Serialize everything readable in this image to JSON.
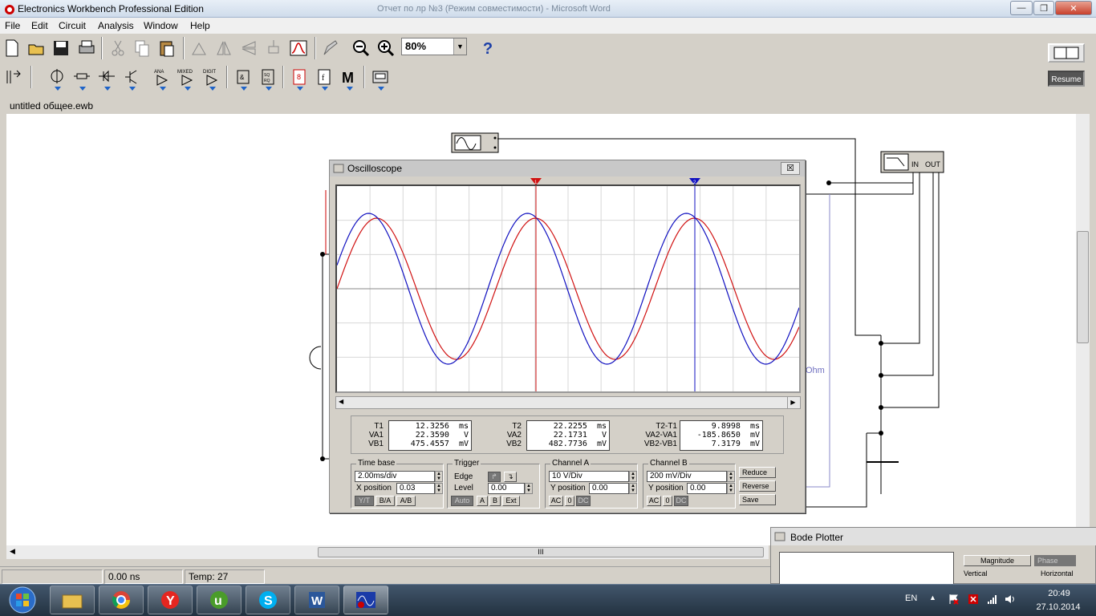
{
  "window": {
    "title": "Electronics Workbench Professional Edition",
    "background_title": "Отчет по лр №3 (Режим совместимости) - Microsoft Word"
  },
  "menu": [
    "File",
    "Edit",
    "Circuit",
    "Analysis",
    "Window",
    "Help"
  ],
  "toolbar": {
    "zoom": "80%",
    "help": "?",
    "resume": "Resume",
    "parts_bins": [
      "ANA",
      "MIXED",
      "DIGIT"
    ]
  },
  "document": {
    "title": "untitled общее.ewb"
  },
  "circuit": {
    "resistor_unit": "Ohm"
  },
  "oscilloscope": {
    "title": "Oscilloscope",
    "close": "☒",
    "cursor1": "1",
    "cursor2": "2",
    "readouts": {
      "t1": {
        "label": "T1",
        "value": "12.3256  ms"
      },
      "va1": {
        "label": "VA1",
        "value": "22.3590   V"
      },
      "vb1": {
        "label": "VB1",
        "value": "475.4557  mV"
      },
      "t2": {
        "label": "T2",
        "value": "22.2255  ms"
      },
      "va2": {
        "label": "VA2",
        "value": "22.1731   V"
      },
      "vb2": {
        "label": "VB2",
        "value": "482.7736  mV"
      },
      "dt": {
        "label": "T2-T1",
        "value": "9.8998  ms"
      },
      "dva": {
        "label": "VA2-VA1",
        "value": "-185.8650  mV"
      },
      "dvb": {
        "label": "VB2-VB1",
        "value": "7.3179  mV"
      }
    },
    "timebase": {
      "label": "Time base",
      "value": "2.00ms/div",
      "xpos_label": "X position",
      "xpos": "0.03",
      "modes": [
        "Y/T",
        "B/A",
        "A/B"
      ]
    },
    "trigger": {
      "label": "Trigger",
      "edge_label": "Edge",
      "level_label": "Level",
      "level": "0.00",
      "sources": [
        "Auto",
        "A",
        "B",
        "Ext"
      ]
    },
    "channel_a": {
      "label": "Channel A",
      "value": "10 V/Div",
      "ypos_label": "Y position",
      "ypos": "0.00",
      "coupling": [
        "AC",
        "0",
        "DC"
      ]
    },
    "channel_b": {
      "label": "Channel B",
      "value": "200 mV/Div",
      "ypos_label": "Y position",
      "ypos": "0.00",
      "coupling": [
        "AC",
        "0",
        "DC"
      ]
    },
    "buttons": {
      "reduce": "Reduce",
      "reverse": "Reverse",
      "save": "Save"
    },
    "colors": {
      "channel_a": "#d01010",
      "channel_b": "#1010c0"
    }
  },
  "bode": {
    "title": "Bode Plotter",
    "magnitude": "Magnitude",
    "phase": "Phase",
    "vertical": "Vertical",
    "horizontal": "Horizontal",
    "in": "IN",
    "out": "OUT"
  },
  "status": {
    "time": "0.00 ns",
    "temp": "Temp:  27"
  },
  "taskbar": {
    "lang": "EN",
    "time": "20:49",
    "date": "27.10.2014"
  }
}
